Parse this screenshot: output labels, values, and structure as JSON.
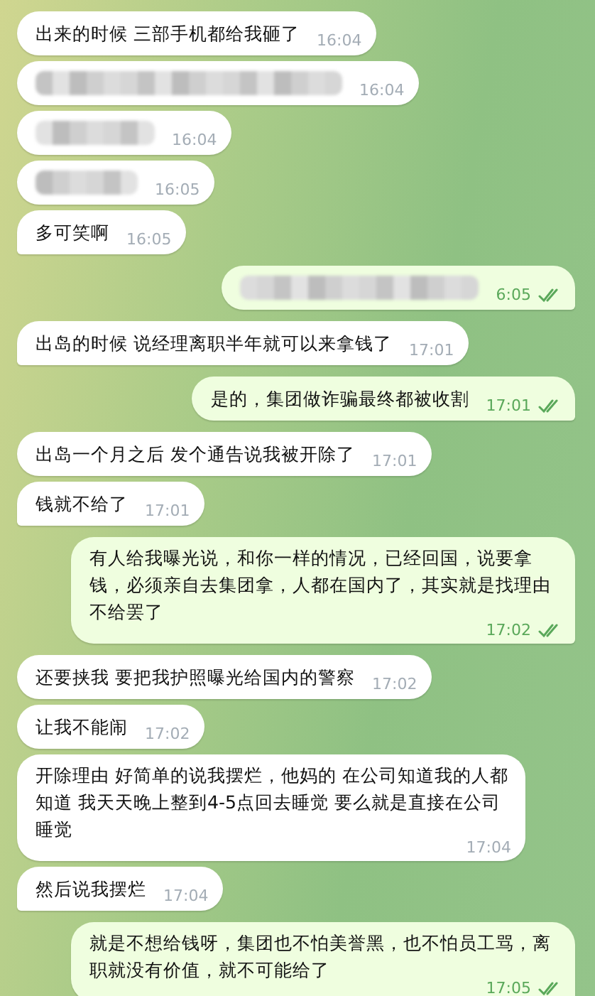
{
  "messages": [
    {
      "outgoing": false,
      "kind": "text",
      "text": "出来的时候 三部手机都给我砸了",
      "time": "16:04",
      "tail": false
    },
    {
      "outgoing": false,
      "kind": "blurred",
      "time": "16:04",
      "tail": false
    },
    {
      "outgoing": false,
      "kind": "blurred",
      "time": "16:04",
      "tail": false
    },
    {
      "outgoing": false,
      "kind": "blurred",
      "time": "16:05",
      "tail": false
    },
    {
      "outgoing": false,
      "kind": "text",
      "text": "多可笑啊",
      "time": "16:05",
      "tail": true
    },
    {
      "outgoing": true,
      "kind": "blurred",
      "time": "6:05",
      "tail": true,
      "read": true
    },
    {
      "outgoing": false,
      "kind": "text",
      "text": "出岛的时候 说经理离职半年就可以来拿钱了",
      "time": "17:01",
      "tail": true
    },
    {
      "outgoing": true,
      "kind": "text",
      "text": "是的，集团做诈骗最终都被收割",
      "time": "17:01",
      "tail": true,
      "read": true
    },
    {
      "outgoing": false,
      "kind": "text",
      "text": "出岛一个月之后 发个通告说我被开除了",
      "time": "17:01",
      "tail": false
    },
    {
      "outgoing": false,
      "kind": "text",
      "text": "钱就不给了",
      "time": "17:01",
      "tail": true
    },
    {
      "outgoing": true,
      "kind": "text",
      "text": "有人给我曝光说，和你一样的情况，已经回国，说要拿钱，必须亲自去集团拿，人都在国内了，其实就是找理由不给罢了",
      "time": "17:02",
      "tail": true,
      "read": true
    },
    {
      "outgoing": false,
      "kind": "text",
      "text": "还要挟我 要把我护照曝光给国内的警察",
      "time": "17:02",
      "tail": false
    },
    {
      "outgoing": false,
      "kind": "text",
      "text": "让我不能闹",
      "time": "17:02",
      "tail": false
    },
    {
      "outgoing": false,
      "kind": "text",
      "text": "开除理由 好简单的说我摆烂，他妈的  在公司知道我的人都知道 我天天晚上整到4-5点回去睡觉 要么就是直接在公司睡觉",
      "time": "17:04",
      "tail": false
    },
    {
      "outgoing": false,
      "kind": "text",
      "text": "然后说我摆烂",
      "time": "17:04",
      "tail": true
    },
    {
      "outgoing": true,
      "kind": "text",
      "text": "就是不想给钱呀，集团也不怕美誉黑，也不怕员工骂，离职就没有价值，就不可能给了",
      "time": "17:05",
      "tail": true,
      "read": true
    }
  ]
}
